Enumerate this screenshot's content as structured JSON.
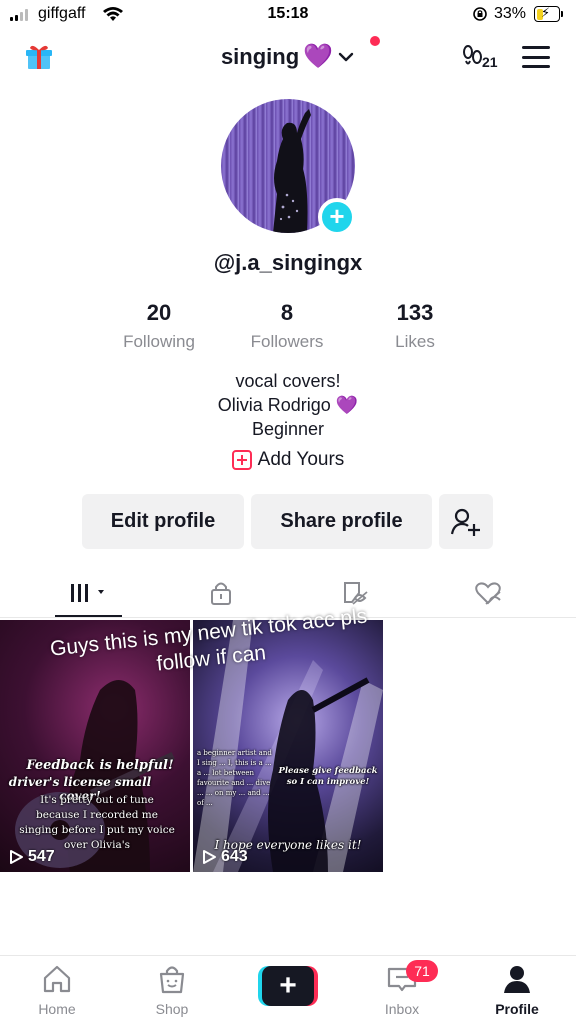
{
  "status_bar": {
    "carrier": "giffgaff",
    "time": "15:18",
    "battery_percent": "33%",
    "battery_level": 0.33
  },
  "header": {
    "username": "singing",
    "username_emoji": "💜",
    "visitors_count": "21",
    "icons": [
      "gift-icon",
      "chevron-down-icon",
      "footprints-icon",
      "menu-icon"
    ]
  },
  "profile": {
    "handle": "@j.a_singingx",
    "stats": [
      {
        "value": "20",
        "label": "Following"
      },
      {
        "value": "8",
        "label": "Followers"
      },
      {
        "value": "133",
        "label": "Likes"
      }
    ],
    "bio": [
      "vocal covers!",
      "Olivia Rodrigo 💜",
      "Beginner"
    ],
    "add_yours": "Add Yours"
  },
  "buttons": {
    "edit_profile": "Edit profile",
    "share_profile": "Share profile"
  },
  "videos": [
    {
      "views": "547",
      "overlay_title": "Feedback is helpful!",
      "overlay_sub": "driver's license small cover!",
      "overlay_body": "It's pretty out of tune because I recorded me singing before I put my voice over Olivia's"
    },
    {
      "views": "643",
      "overlay_left": "a beginner artist and I sing ... I, this is a ... a ... lot between favourite and ... dive ... ... on my ... and ... of ...",
      "overlay_right": "Please give feedback so I can improve!",
      "overlay_bottom": "I hope everyone likes it!"
    }
  ],
  "caption_overlay": "Guys this is my new tik tok acc pls follow if can",
  "bottom_nav": {
    "home": "Home",
    "shop": "Shop",
    "inbox": "Inbox",
    "inbox_badge": "71",
    "profile": "Profile"
  },
  "colors": {
    "accent_red": "#fe2c55",
    "accent_cyan": "#20d5ec",
    "text_primary": "#161823",
    "text_secondary": "#8a8b91"
  }
}
